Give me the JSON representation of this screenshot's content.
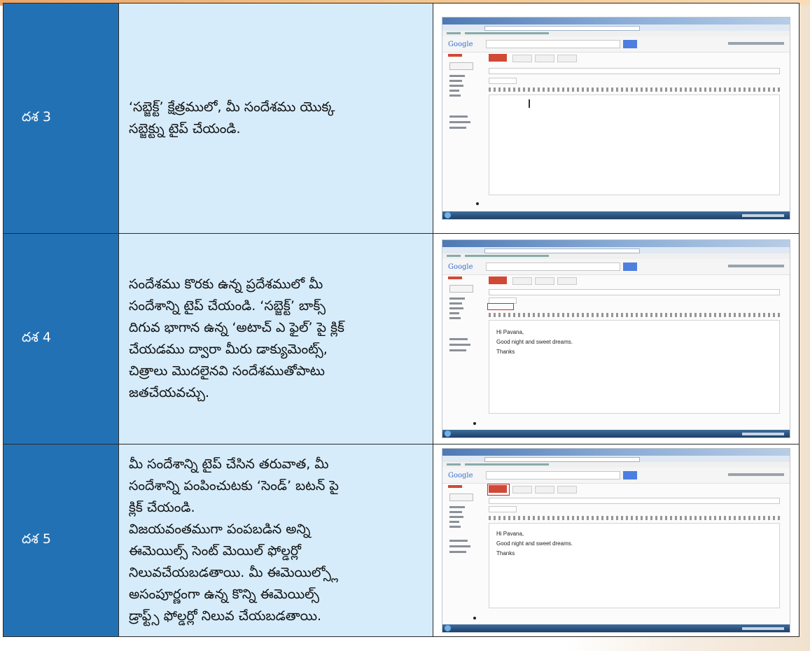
{
  "rows": [
    {
      "step": "దశ 3",
      "lines": [
        "‘సబ్జెక్ట్’ క్షేత్రములో, మీ సందేశము యొక్క",
        "సబ్జెక్ట్ను టైప్ చేయండి."
      ],
      "screenshot": {
        "logo": "Google",
        "body_lines": []
      }
    },
    {
      "step": "దశ 4",
      "lines": [
        "సందేశము కొరకు ఉన్న ప్రదేశములో మీ",
        "సందేశాన్ని టైప్ చేయండి. ‘సబ్జెక్ట్’ బాక్స్",
        "దిగువ భాగాన ఉన్న ‘అటాచ్ ఎ ఫైల్’ పై క్లిక్",
        "చేయడము ద్వారా మీరు డాక్యుమెంట్స్,",
        "చిత్రాలు మొదలైనవి సందేశముతోపాటు",
        "జతచేయవచ్చు."
      ],
      "screenshot": {
        "logo": "Google",
        "body_lines": [
          "Hi Pavana,",
          "Good night and sweet dreams.",
          "Thanks"
        ]
      }
    },
    {
      "step": "దశ 5",
      "lines": [
        "మీ సందేశాన్ని టైప్ చేసిన తరువాత, మీ",
        "సందేశాన్ని పంపించుటకు ‘సెండ్’ బటన్ పై",
        "క్లిక్ చేయండి.",
        "విజయవంతముగా పంపబడిన అన్ని",
        "ఈమెయిల్స్ సెంట్ మెయిల్ ఫోల్డర్లో",
        "నిలువచేయబడతాయి. మీ ఈమెయిల్స్లో",
        "అసంపూర్ణంగా ఉన్న కొన్ని ఈమెయిల్స్",
        "డ్రాఫ్ట్స్ ఫోల్డర్లో నిలువ చేయబడతాయి."
      ],
      "screenshot": {
        "logo": "Google",
        "body_lines": [
          "Hi Pavana,",
          "Good night and sweet dreams.",
          "Thanks"
        ]
      }
    }
  ]
}
